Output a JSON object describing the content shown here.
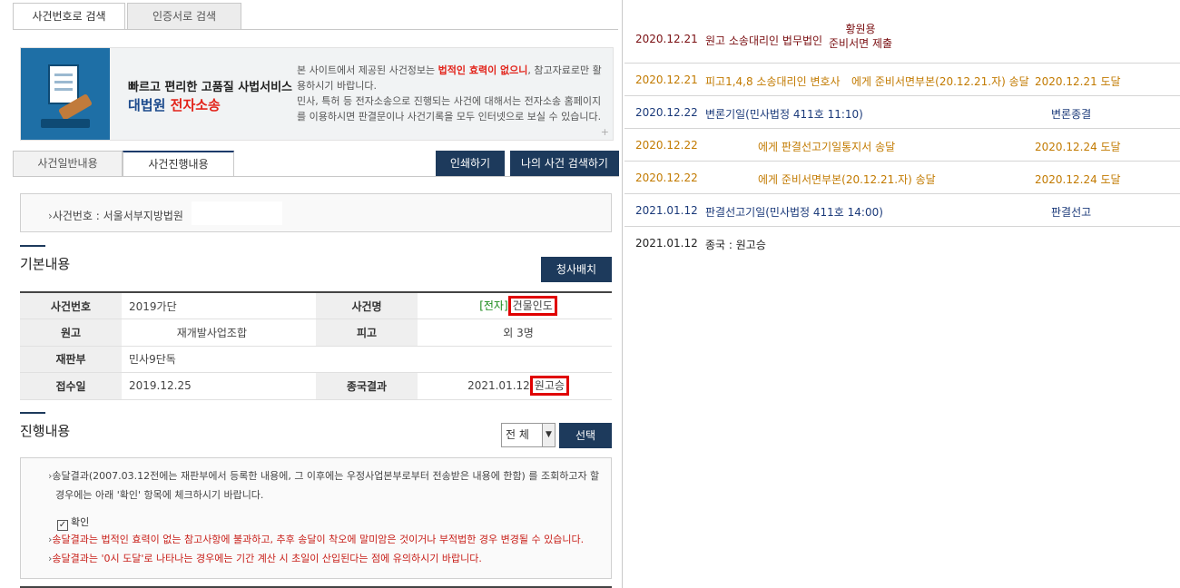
{
  "top_tabs": [
    {
      "label": "사건번호로 검색",
      "active": true
    },
    {
      "label": "인증서로 검색",
      "active": false
    }
  ],
  "banner": {
    "headline": "빠르고 편리한 고품질 사법서비스",
    "brand_prefix": "대법원",
    "brand_suffix": "전자소송",
    "text_part1": "본 사이트에서 제공된 사건정보는 ",
    "text_warning": "법적인 효력이 없으니",
    "text_part2": ", 참고자료로만 활용하시기 바랍니다.",
    "text_line2": "민사, 특허 등 전자소송으로 진행되는 사건에 대해서는 전자소송 홈페이지를 이용하시면 판결문이나 사건기록을 모두 인터넷으로 보실 수 있습니다.",
    "plus": "+"
  },
  "sub_tabs": [
    {
      "label": "사건일반내용",
      "active": false
    },
    {
      "label": "사건진행내용",
      "active": true
    }
  ],
  "buttons": {
    "print": "인쇄하기",
    "my_case_search": "나의 사건 검색하기",
    "cheongsa": "청사배치",
    "select": "선택"
  },
  "case_number_label": "사건번호 : 서울서부지방법원",
  "basic_info": {
    "title": "기본내용",
    "rows": [
      {
        "h1": "사건번호",
        "v1": "2019가단",
        "h2": "사건명",
        "v2_tag": "[전자]",
        "v2": "건물인도"
      },
      {
        "h1": "원고",
        "v1": "재개발사업조합",
        "h2": "피고",
        "v2": "외 3명"
      },
      {
        "h1": "재판부",
        "v1": "민사9단독"
      },
      {
        "h1": "접수일",
        "v1": "2019.12.25",
        "h2": "종국결과",
        "v2_date": "2021.01.12",
        "v2": "원고승"
      }
    ]
  },
  "progress": {
    "title": "진행내용",
    "filter_value": "전 체",
    "filter_arrow": "▼"
  },
  "notice": {
    "line1": "송달결과(2007.03.12전에는 재판부에서 등록한 내용에, 그 이후에는 우정사업본부로부터 전송받은 내용에 한함) 를 조회하고자 할",
    "line2": "경우에는 아래 '확인' 항목에 체크하시기 바랍니다.",
    "checkbox_label": "확인",
    "checkbox_mark": "✓",
    "warn1": "송달결과는 법적인 효력이 없는 참고사항에 불과하고, 추후 송달이 착오에 말미암은 것이거나 부적법한 경우 변경될 수 있습니다.",
    "warn2": "송달결과는 '0시 도달'로 나타나는 경우에는 기간 계산 시 초일이 산입된다는 점에 유의하시기 바랍니다."
  },
  "records": [
    {
      "date": "2020.12.21",
      "content": "원고 소송대리인 법무법인",
      "stack1": "황원용",
      "stack2": "준비서면 제출",
      "result": "",
      "color": "maroon"
    },
    {
      "date": "2020.12.21",
      "content": "피고1,4,8 소송대리인 변호사",
      "content2": "에게 준비서면부본(20.12.21.자) 송달",
      "result": "2020.12.21 도달",
      "color": "brown"
    },
    {
      "date": "2020.12.22",
      "content": "변론기일(민사법정 411호 11:10)",
      "result": "변론종결",
      "color": "navy"
    },
    {
      "date": "2020.12.22",
      "content": "",
      "content2": "에게 판결선고기일통지서 송달",
      "result": "2020.12.24 도달",
      "color": "brown"
    },
    {
      "date": "2020.12.22",
      "content": "",
      "content2": "에게 준비서면부본(20.12.21.자) 송달",
      "result": "2020.12.24 도달",
      "color": "brown"
    },
    {
      "date": "2021.01.12",
      "content": "판결선고기일(민사법정 411호 14:00)",
      "result": "판결선고",
      "color": "navy"
    },
    {
      "date": "2021.01.12",
      "content": "종국 : 원고승",
      "result": "",
      "color": "black"
    }
  ]
}
